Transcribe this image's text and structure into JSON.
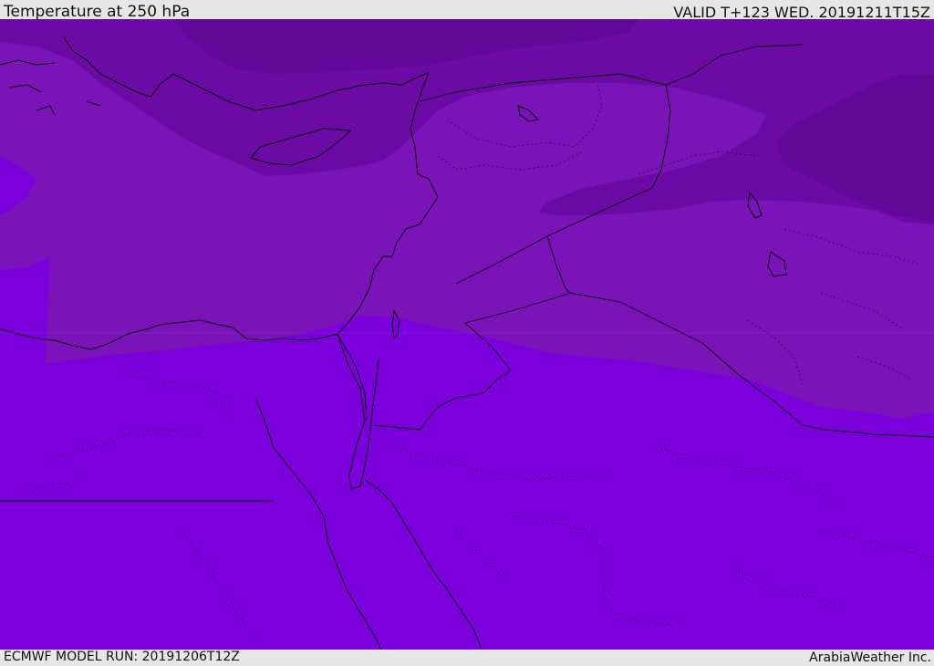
{
  "header": {
    "title": "Temperature at 250 hPa",
    "valid_time": "VALID T+123 WED. 20191211T15Z"
  },
  "footer": {
    "model_run": "ECMWF MODEL RUN: 20191206T12Z",
    "provider": "ArabiaWeather Inc."
  },
  "colors": {
    "band_warm": "#7c00dc",
    "band_mid": "#7a14b8",
    "band_cool": "#6c0aa6",
    "band_cold": "#600898",
    "coastline": "#000000",
    "frame": "#e6e6e6"
  },
  "map": {
    "region": "Eastern Mediterranean and Middle East",
    "layers": [
      "temperature-shading",
      "coastlines",
      "country-borders",
      "internal-borders"
    ]
  }
}
